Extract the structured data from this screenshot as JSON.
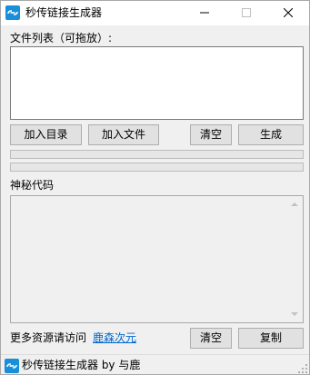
{
  "window": {
    "title": "秒传链接生成器",
    "app_icon": "link-cloud-icon",
    "controls": {
      "minimize": "minimize-icon",
      "maximize": "maximize-icon",
      "close": "close-icon"
    }
  },
  "file_list": {
    "label": "文件列表（可拖放）:",
    "items": []
  },
  "actions": {
    "add_dir": "加入目录",
    "add_file": "加入文件",
    "clear": "清空",
    "generate": "生成"
  },
  "progress": [
    {
      "value": 0
    },
    {
      "value": 0
    }
  ],
  "output": {
    "label": "神秘代码",
    "value": ""
  },
  "footer": {
    "more_text": "更多资源请访问",
    "link_text": "鹿森次元",
    "clear": "清空",
    "copy": "复制"
  },
  "statusbar": {
    "text": "秒传链接生成器 by 与鹿"
  },
  "colors": {
    "accent": "#0078d7",
    "link": "#0066cc"
  }
}
